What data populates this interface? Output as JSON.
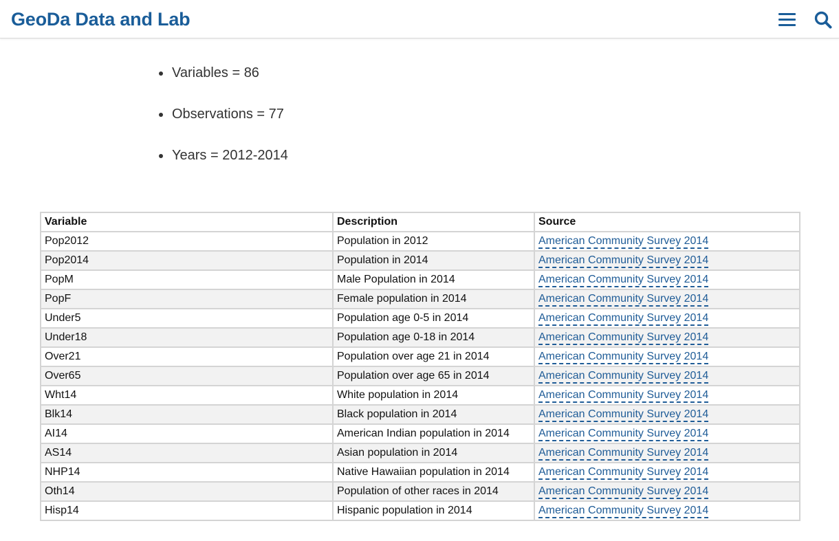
{
  "header": {
    "site_title": "GeoDa Data and Lab",
    "menu_icon": "hamburger-menu-icon",
    "search_icon": "search-icon",
    "accent_color": "#1a5d99"
  },
  "stats": [
    {
      "text": "Variables = 86"
    },
    {
      "text": "Observations = 77"
    },
    {
      "text": "Years = 2012-2014"
    }
  ],
  "table": {
    "headers": [
      "Variable",
      "Description",
      "Source"
    ],
    "rows": [
      {
        "variable": "Pop2012",
        "description": "Population in 2012",
        "source": "American Community Survey 2014"
      },
      {
        "variable": "Pop2014",
        "description": "Population in 2014",
        "source": "American Community Survey 2014"
      },
      {
        "variable": "PopM",
        "description": "Male Population in 2014",
        "source": "American Community Survey 2014"
      },
      {
        "variable": "PopF",
        "description": "Female population in 2014",
        "source": "American Community Survey 2014"
      },
      {
        "variable": "Under5",
        "description": "Population age 0-5 in 2014",
        "source": "American Community Survey 2014"
      },
      {
        "variable": "Under18",
        "description": "Population age 0-18 in 2014",
        "source": "American Community Survey 2014"
      },
      {
        "variable": "Over21",
        "description": "Population over age 21 in 2014",
        "source": "American Community Survey 2014"
      },
      {
        "variable": "Over65",
        "description": "Population over age 65 in 2014",
        "source": "American Community Survey 2014"
      },
      {
        "variable": "Wht14",
        "description": "White population in 2014",
        "source": "American Community Survey 2014"
      },
      {
        "variable": "Blk14",
        "description": "Black population in 2014",
        "source": "American Community Survey 2014"
      },
      {
        "variable": "AI14",
        "description": "American Indian population in 2014",
        "source": "American Community Survey 2014"
      },
      {
        "variable": "AS14",
        "description": "Asian population in 2014",
        "source": "American Community Survey 2014"
      },
      {
        "variable": "NHP14",
        "description": "Native Hawaiian population in 2014",
        "source": "American Community Survey 2014"
      },
      {
        "variable": "Oth14",
        "description": "Population of other races in 2014",
        "source": "American Community Survey 2014"
      },
      {
        "variable": "Hisp14",
        "description": "Hispanic population in 2014",
        "source": "American Community Survey 2014"
      }
    ]
  }
}
